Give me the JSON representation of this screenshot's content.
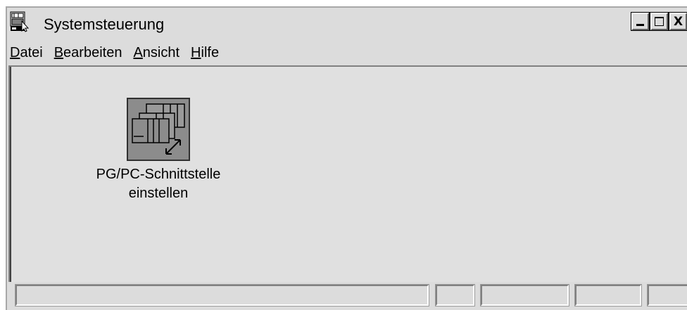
{
  "window": {
    "title": "Systemsteuerung",
    "title_icon": "control-panel-icon",
    "controls": [
      "minimize-icon",
      "maximize-icon",
      "close-icon"
    ],
    "close_glyph": "X"
  },
  "menubar": {
    "items": [
      {
        "accel": "D",
        "rest": "atei"
      },
      {
        "accel": "B",
        "rest": "earbeiten"
      },
      {
        "accel": "A",
        "rest": "nsicht"
      },
      {
        "accel": "H",
        "rest": "ilfe"
      }
    ]
  },
  "applets": [
    {
      "icon": "pg-pc-interface-icon",
      "label_line1": "PG/PC-Schnittstelle",
      "label_line2": "einstellen"
    }
  ],
  "statusbar": {
    "panels": [
      "",
      "",
      "",
      "",
      ""
    ]
  },
  "colors": {
    "window_bg": "#dcdcdc",
    "content_bg": "#e0e0e0",
    "icon_bg": "#8c8c8c"
  }
}
